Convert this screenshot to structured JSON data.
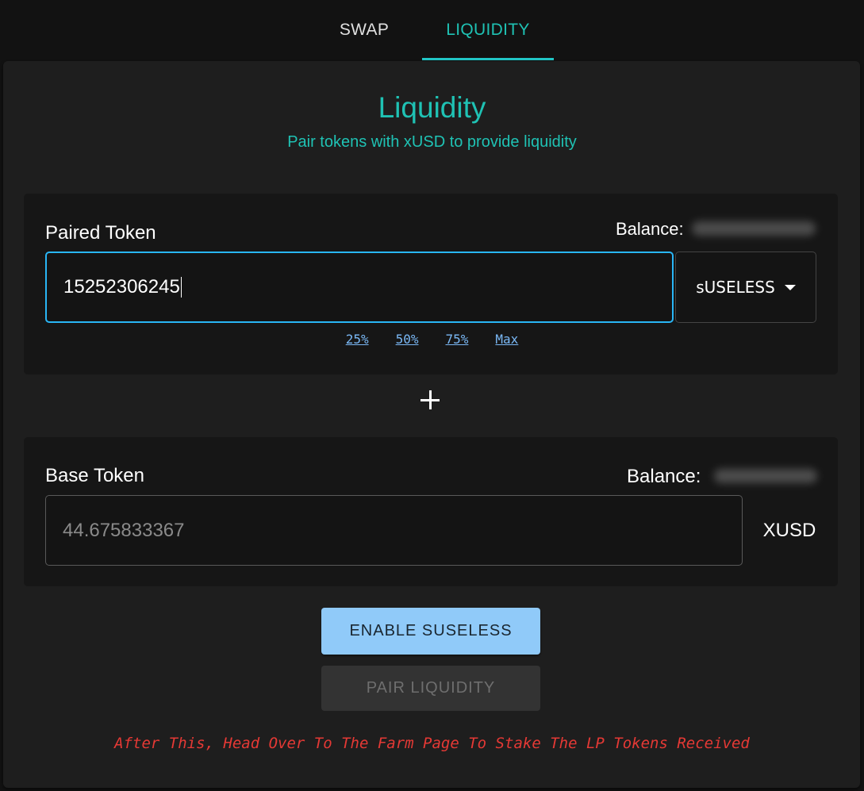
{
  "tabs": [
    {
      "label": "SWAP",
      "active": false
    },
    {
      "label": "LIQUIDITY",
      "active": true
    }
  ],
  "header": {
    "title": "Liquidity",
    "subtitle": "Pair tokens with xUSD to provide liquidity"
  },
  "paired": {
    "label": "Paired Token",
    "balance_label": "Balance:",
    "balance_value": "",
    "amount": "15252306245",
    "token": "sUSELESS",
    "percent_options": [
      "25%",
      "50%",
      "75%",
      "Max"
    ]
  },
  "plus_icon": "plus-icon",
  "base": {
    "label": "Base Token",
    "balance_label": "Balance:",
    "balance_value": "",
    "amount": "44.675833367",
    "token": "XUSD"
  },
  "buttons": {
    "enable": "ENABLE SUSELESS",
    "pair": "PAIR LIQUIDITY"
  },
  "note": "After This, Head Over To The Farm Page To Stake The LP Tokens Received",
  "colors": {
    "accent": "#1fc2b4",
    "input_focus": "#29b6f6",
    "enable_button": "#90caf9",
    "note": "#e53935"
  }
}
